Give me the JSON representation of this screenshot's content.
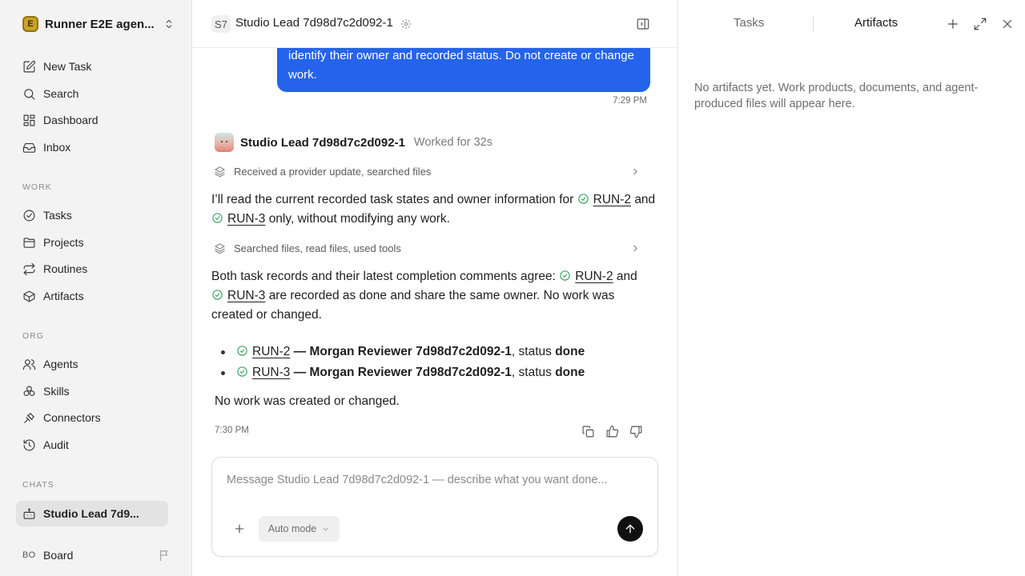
{
  "sidebar": {
    "workspace": {
      "logo": "E",
      "name": "Runner E2E agen..."
    },
    "top_items": [
      {
        "label": "New Task",
        "icon": "edit-icon"
      },
      {
        "label": "Search",
        "icon": "search-icon"
      },
      {
        "label": "Dashboard",
        "icon": "dashboard-icon"
      },
      {
        "label": "Inbox",
        "icon": "inbox-icon"
      }
    ],
    "work_section": "WORK",
    "work_items": [
      {
        "label": "Tasks",
        "icon": "check-circle-icon"
      },
      {
        "label": "Projects",
        "icon": "folder-icon"
      },
      {
        "label": "Routines",
        "icon": "repeat-icon"
      },
      {
        "label": "Artifacts",
        "icon": "box-icon"
      }
    ],
    "org_section": "ORG",
    "org_items": [
      {
        "label": "Agents",
        "icon": "users-icon"
      },
      {
        "label": "Skills",
        "icon": "skills-icon"
      },
      {
        "label": "Connectors",
        "icon": "plug-icon"
      },
      {
        "label": "Audit",
        "icon": "history-icon"
      }
    ],
    "chats_section": "CHATS",
    "chat_item": "Studio Lead 7d9...",
    "board": {
      "avatar": "BO",
      "label": "Board"
    }
  },
  "header": {
    "badge": "S7",
    "title": "Studio Lead 7d98d7c2d092-1"
  },
  "conversation": {
    "user_bubble": "identify their owner and recorded status. Do not create or change work.",
    "user_time": "7:29 PM",
    "agent_name": "Studio Lead 7d98d7c2d092-1",
    "worked": "Worked for 32s",
    "activity1": "Received a provider update, searched files",
    "para1": {
      "a": "I’ll read the current recorded task states and owner information for",
      "link1": "RUN-2",
      "b": "and",
      "link2": "RUN-3",
      "c": "only, without modifying any work."
    },
    "activity2": "Searched files, read files, used tools",
    "para2": {
      "a": "Both task records and their latest completion comments agree:",
      "link1": "RUN-2",
      "b": "and",
      "link2": "RUN-3",
      "c": "are recorded as done and share the same owner. No work was created or changed."
    },
    "bullets": [
      {
        "task": "RUN-2",
        "sep": " — ",
        "owner": "Morgan Reviewer 7d98d7c2d092-1",
        "mid": ", status ",
        "status": "done"
      },
      {
        "task": "RUN-3",
        "sep": " — ",
        "owner": "Morgan Reviewer 7d98d7c2d092-1",
        "mid": ", status ",
        "status": "done"
      }
    ],
    "final_line": "No work was created or changed.",
    "agent_time": "7:30 PM"
  },
  "composer": {
    "placeholder": "Message Studio Lead 7d98d7c2d092-1 — describe what you want done...",
    "mode": "Auto mode"
  },
  "right_panel": {
    "tabs": [
      "Tasks",
      "Artifacts"
    ],
    "active_tab": "Artifacts",
    "empty_message": "No artifacts yet. Work products, documents, and agent-produced files will appear here."
  },
  "colors": {
    "accent": "#2563eb",
    "success": "#2e9b55",
    "sidebar_bg": "#f3f3f3"
  }
}
